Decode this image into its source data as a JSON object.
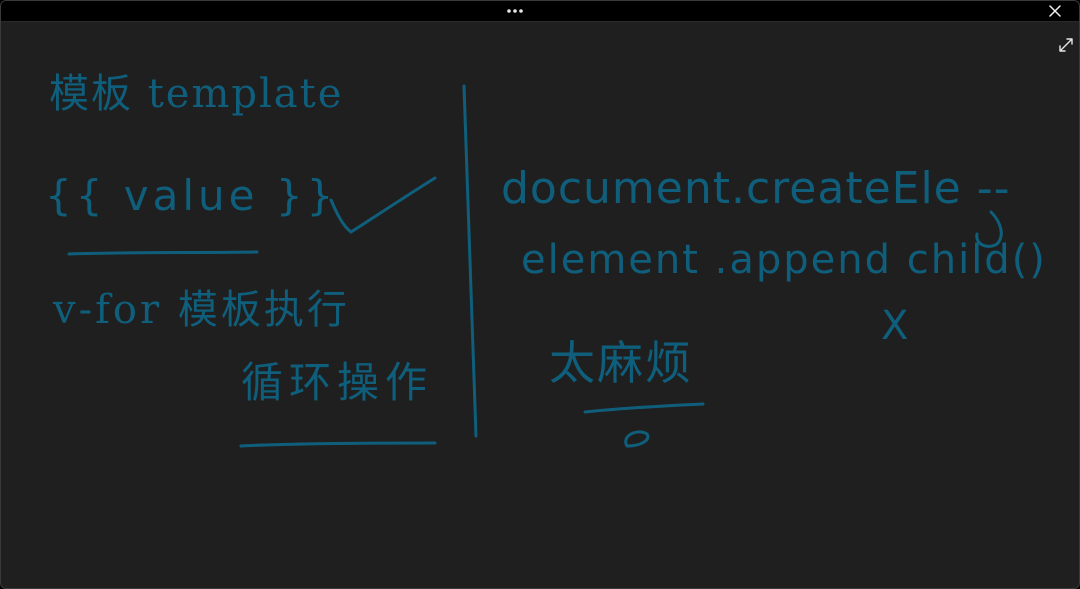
{
  "window": {
    "controls": {
      "drag_icon": "more-horizontal-icon",
      "close_icon": "close-icon",
      "expand_icon": "expand-icon"
    }
  },
  "whiteboard": {
    "ink_color": "#0f5f7c",
    "background_color": "#1f1f1f",
    "left": {
      "title": "模板 template",
      "interpolation": "{{ value }}",
      "check_mark": "✓",
      "vfor_line1": "v-for 模板执行",
      "vfor_line2": "循环操作"
    },
    "right": {
      "line1": "document.createEle --",
      "line2": "element .append child()",
      "cross_mark": "X",
      "conclusion": "太麻烦"
    }
  }
}
